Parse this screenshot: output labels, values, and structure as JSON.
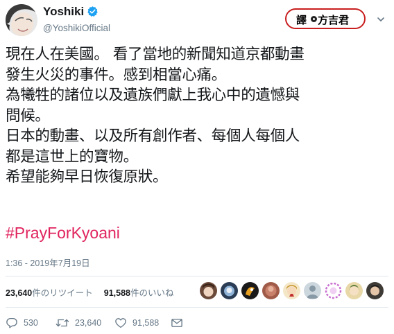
{
  "user": {
    "display_name": "Yoshiki",
    "handle": "@YoshikiOfficial",
    "verified": true
  },
  "translator_badge": {
    "part1": "譯",
    "part2": "方吉君"
  },
  "tweet": {
    "lines": [
      "現在人在美國。 看了當地的新聞知道京都動畫",
      "發生火災的事件。感到相當心痛。",
      "為犧牲的諸位以及遺族們獻上我心中的遺憾與",
      "問候。",
      "日本的動畫、以及所有創作者、每個人每個人",
      "都是這世上的寶物。",
      "希望能夠早日恢復原狀。"
    ],
    "hashtag": "#PrayForKyoani",
    "timestamp": "1:36 - 2019年7月19日"
  },
  "stats": {
    "retweets_count": "23,640",
    "retweets_label": "件のリツイート",
    "likes_count": "91,588",
    "likes_label": "件のいいね"
  },
  "actions": {
    "reply_count": "530",
    "retweet_count": "23,640",
    "like_count": "91,588"
  },
  "colors": {
    "hashtag": "#e0245e",
    "verified": "#1da1f2",
    "muted": "#657786",
    "badge_border": "#c81e1e"
  },
  "icons": [
    "verified-badge-icon",
    "chevron-down-icon",
    "reply-icon",
    "retweet-icon",
    "like-icon",
    "direct-message-icon"
  ]
}
